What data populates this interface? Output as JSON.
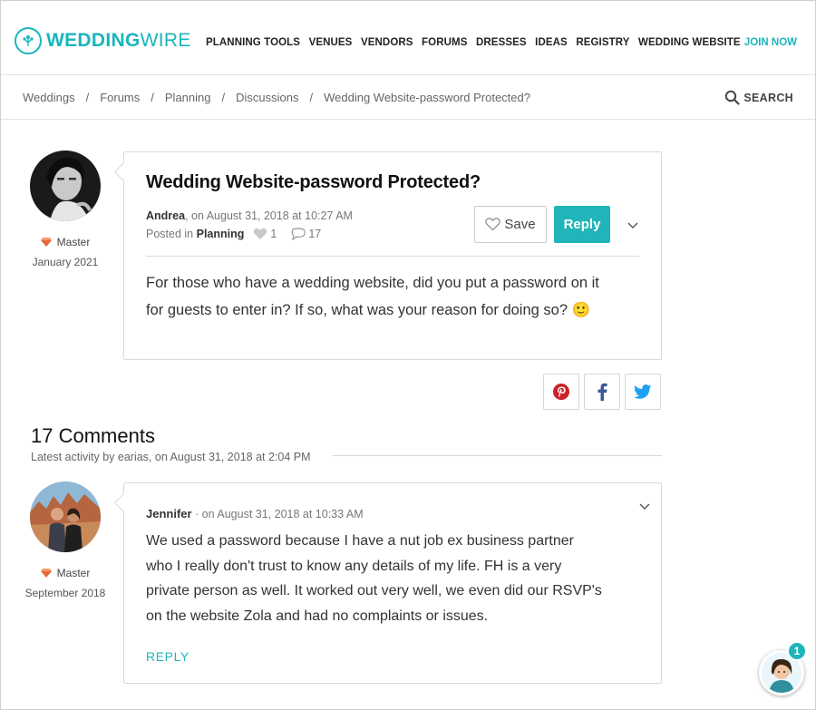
{
  "brand": {
    "name_bold": "WEDDING",
    "name_rest": "WIRE",
    "accent": "#19b5bc"
  },
  "nav": [
    "PLANNING TOOLS",
    "VENUES",
    "VENDORS",
    "FORUMS",
    "DRESSES",
    "IDEAS",
    "REGISTRY",
    "WEDDING WEBSITE"
  ],
  "join": "JOIN NOW",
  "breadcrumb": [
    "Weddings",
    "Forums",
    "Planning",
    "Discussions",
    "Wedding Website-password Protected?"
  ],
  "breadcrumb_sep": "/",
  "search_label": "SEARCH",
  "post": {
    "title": "Wedding Website-password Protected?",
    "author": "Andrea",
    "date": ", on August 31, 2018 at 10:27 AM",
    "posted_in_label": "Posted in",
    "category": "Planning",
    "likes": "1",
    "comments": "17",
    "save_label": "Save",
    "reply_label": "Reply",
    "body_line1": "For those who have a wedding website, did you put a password on it",
    "body_line2": "for guests to enter in? If so, what was your reason for doing so?",
    "emoji": "🙂",
    "author_rank": "Master",
    "author_since": "January 2021"
  },
  "comments_header": {
    "title": "17 Comments",
    "latest": "Latest activity by earias, on August 31, 2018 at 2:04 PM"
  },
  "comments": [
    {
      "author": "Jennifer",
      "date": " · on August 31, 2018 at 10:33 AM",
      "lines": [
        "We used a password because I have a nut job ex business partner",
        "who I really don't trust to know any details of my life. FH is a very",
        "private person as well. It worked out very well, we even did our RSVP's",
        "on the website Zola and had no complaints or issues."
      ],
      "reply_label": "REPLY",
      "rank": "Master",
      "since": "September 2018"
    }
  ],
  "chat_badge": "1",
  "colors": {
    "teal": "#20b5b8",
    "pinterest": "#cb2027",
    "facebook": "#3b5998",
    "twitter": "#1da1f2",
    "gem": "#e8683a"
  }
}
